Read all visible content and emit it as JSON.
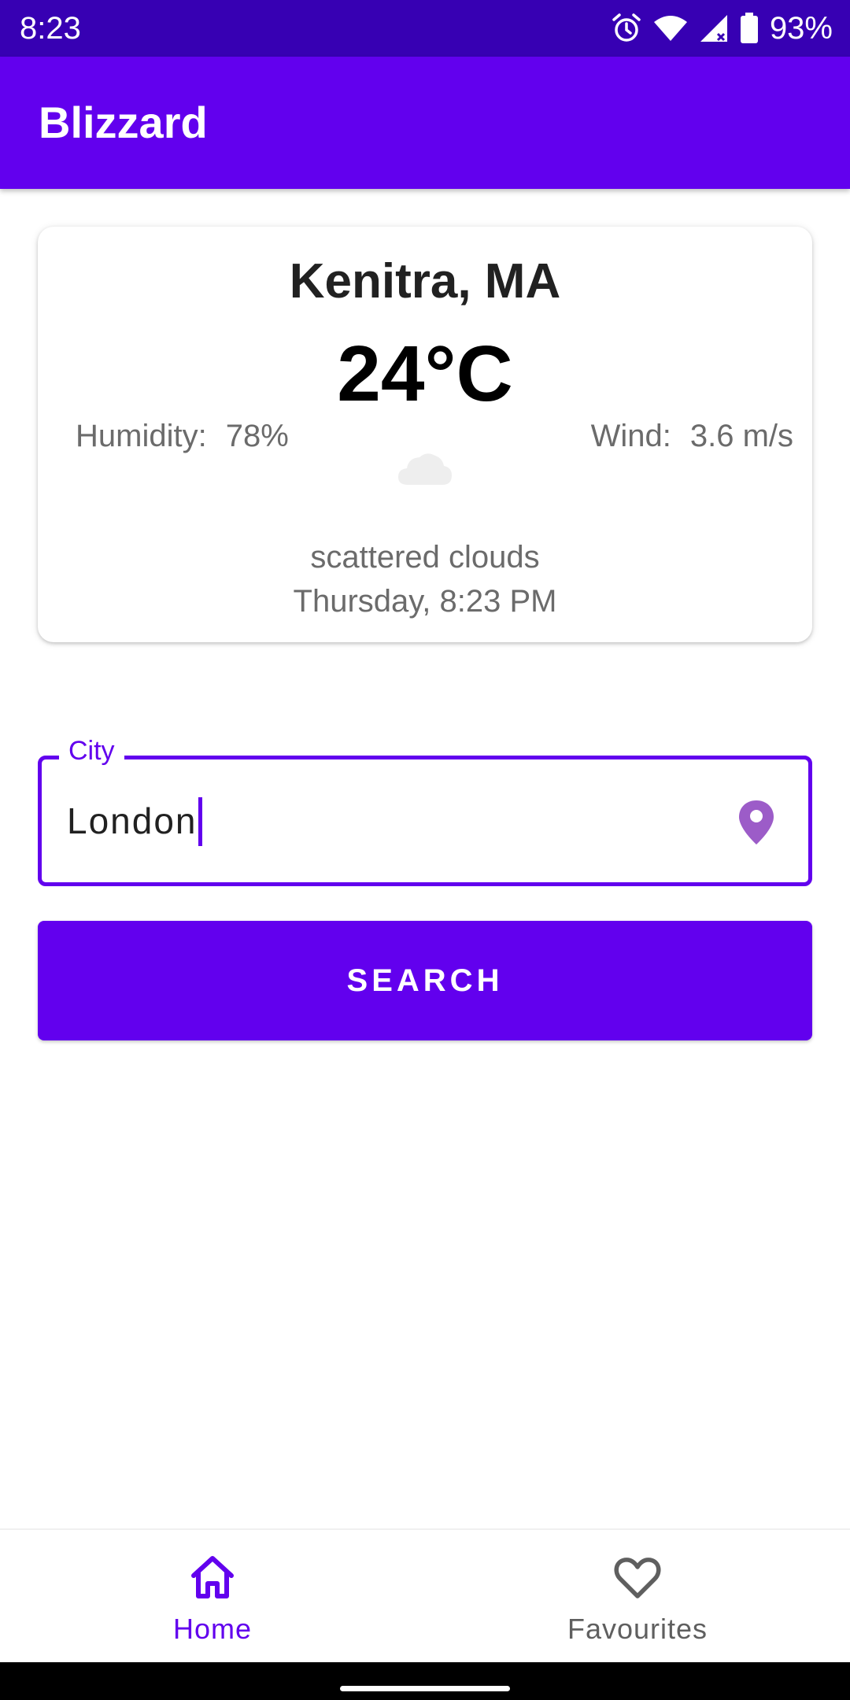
{
  "status_bar": {
    "time": "8:23",
    "battery": "93%",
    "icons": [
      "alarm-icon",
      "wifi-icon",
      "signal-icon",
      "battery-icon"
    ]
  },
  "app_bar": {
    "title": "Blizzard"
  },
  "weather": {
    "city": "Kenitra, MA",
    "temperature": "24°C",
    "humidity_label": "Humidity:",
    "humidity_value": "78%",
    "wind_label": "Wind:",
    "wind_value": "3.6 m/s",
    "icon": "cloud-icon",
    "description": "scattered clouds",
    "datetime": "Thursday, 8:23 PM"
  },
  "search": {
    "field_label": "City",
    "field_value": "London",
    "trailing_icon": "location-pin-icon",
    "button_label": "SEARCH"
  },
  "bottom_nav": {
    "items": [
      {
        "label": "Home",
        "icon": "home-icon",
        "selected": true
      },
      {
        "label": "Favourites",
        "icon": "heart-icon",
        "selected": false
      }
    ]
  },
  "colors": {
    "primary": "#6200ee",
    "primary_dark": "#3700b3",
    "location_icon": "#9c5cc8",
    "secondary_text": "#6b6b6b"
  }
}
